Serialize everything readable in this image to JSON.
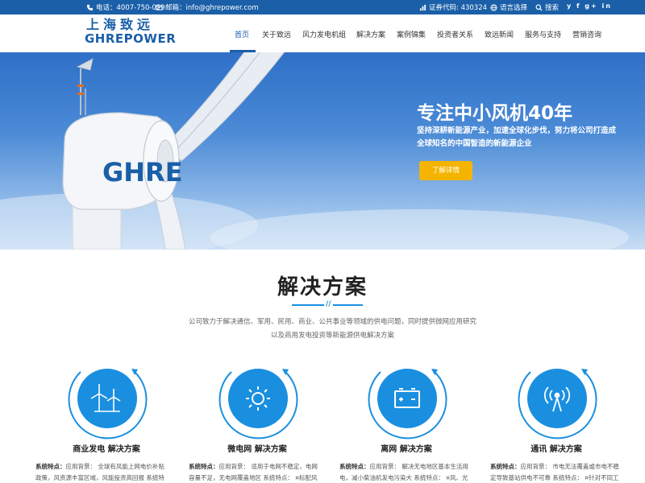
{
  "topbar": {
    "phone": "电话：4007-750-029",
    "email": "邮箱：info@ghrepower.com",
    "stock": "证券代码: 430324",
    "language": "语言选择",
    "search": "搜索",
    "social": "y f g+ in"
  },
  "header": {
    "logo_cn": "上海致远",
    "logo_en": "GHREPOWER"
  },
  "nav": {
    "items": [
      {
        "label": "首页"
      },
      {
        "label": "关于致远"
      },
      {
        "label": "风力发电机组"
      },
      {
        "label": "解决方案"
      },
      {
        "label": "案例锦集"
      },
      {
        "label": "投资者关系"
      },
      {
        "label": "致远新闻"
      },
      {
        "label": "服务与支持"
      },
      {
        "label": "营销咨询"
      }
    ]
  },
  "hero": {
    "turbine_text": "GHRE",
    "title": "专注中小风机40年",
    "desc": "坚持深耕新能源产业，加速全球化步伐，努力将公司打造成全球知名的中国智造的新能源企业",
    "button": "了解详情"
  },
  "solutions": {
    "title": "解决方案",
    "divider_mark": "//",
    "desc": "公司致力于解决通信、军用、民用、商业、公共事业等领域的供电问题，同时提供微网应用研究以及商用发电投资等新能源供电解决方案",
    "cards": [
      {
        "title": "商业发电 解决方案",
        "icon": "wind-turbine-icon",
        "line1_label": "系统特点：",
        "line1": "应用背景： 全球有风能上网电价补贴",
        "line2": "政策，风资源丰富区域，风能投资高回报 系统特"
      },
      {
        "title": "微电网 解决方案",
        "icon": "sun-icon",
        "line1_label": "系统特点：",
        "line1": "应用背景： 适用于电网不稳定，电网",
        "line2": "容量不足，无电网覆盖地区 系统特点： ¤标配风"
      },
      {
        "title": "离网 解决方案",
        "icon": "battery-icon",
        "line1_label": "系统特点：",
        "line1": "应用背景： 解决无电地区基本生活用",
        "line2": "电，减小柴油机发电污染大 系统特点： ¤风、光"
      },
      {
        "title": "通讯 解决方案",
        "icon": "signal-tower-icon",
        "line1_label": "系统特点：",
        "line1": "应用背景： 市电无法覆盖或市电不稳",
        "line2": "定导致基站供电不可靠 系统特点： ¤针对不同工"
      }
    ]
  },
  "colors": {
    "brand_blue": "#1a5fa8",
    "accent_blue": "#1a8fe0",
    "button_yellow": "#f5b400"
  }
}
